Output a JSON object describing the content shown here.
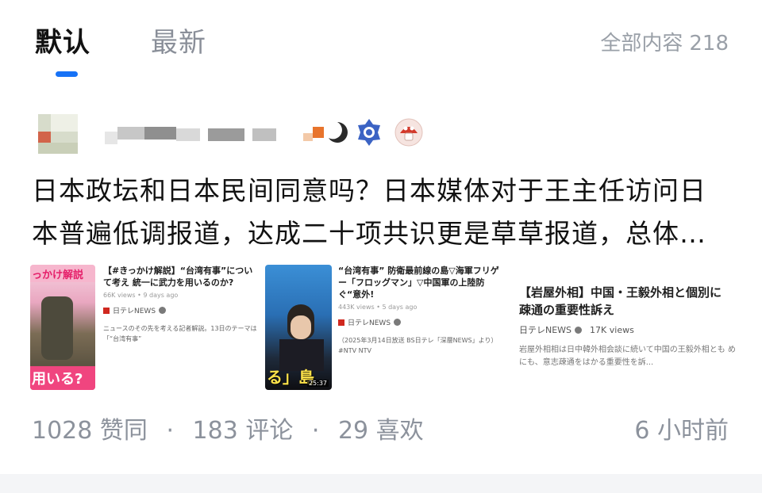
{
  "tabs": {
    "default": "默认",
    "latest": "最新",
    "total_label": "全部内容",
    "total_count": "218"
  },
  "badges": [
    "half-moon-icon",
    "blue-star-badge-icon",
    "mushroom-badge-icon"
  ],
  "post": {
    "headline": "日本政坛和日本民间同意吗？日本媒体对于王主任访问日本普遍低调报道，达成二十项共识更是草草报道，总体…",
    "cards": [
      {
        "thumb_text": "っかけ解説",
        "thumb_bottom": "用いる?",
        "title": "【#きっかけ解説】“台湾有事”について考え 統一に武力を用いるのか?",
        "meta": "66K views • 9 days ago",
        "source": "日テレNEWS",
        "desc": "ニュースのその先を考える記者解説。13日のテーマは「“台湾有事”"
      },
      {
        "thumb_text": "る」島",
        "thumb_time": "25:37",
        "title": "“台湾有事” 防衛最前線の島▽海軍フリゲー「フロッグマン」▽中国軍の上陸防ぐ“意外!",
        "meta": "443K views • 5 days ago",
        "source": "日テレNEWS",
        "desc": "（2025年3月14日放送 BS日テレ「深層NEWS」より）#NTV NTV"
      },
      {
        "title": "【岩屋外相】中国・王毅外相と個別に 疎通の重要性訴え",
        "source": "日テレNEWS",
        "views": "17K views",
        "desc": "岩屋外相相は日中韓外相会談に続いて中国の王毅外相とも めにも、意志疎通をはかる重要性を訴..."
      }
    ]
  },
  "stats": {
    "likes": "1028 赞同",
    "comments": "183 评论",
    "favorites": "29 喜欢",
    "separator": "·",
    "time": "6 小时前"
  },
  "colors": {
    "accent": "#1772f6",
    "muted": "#8c929c"
  }
}
